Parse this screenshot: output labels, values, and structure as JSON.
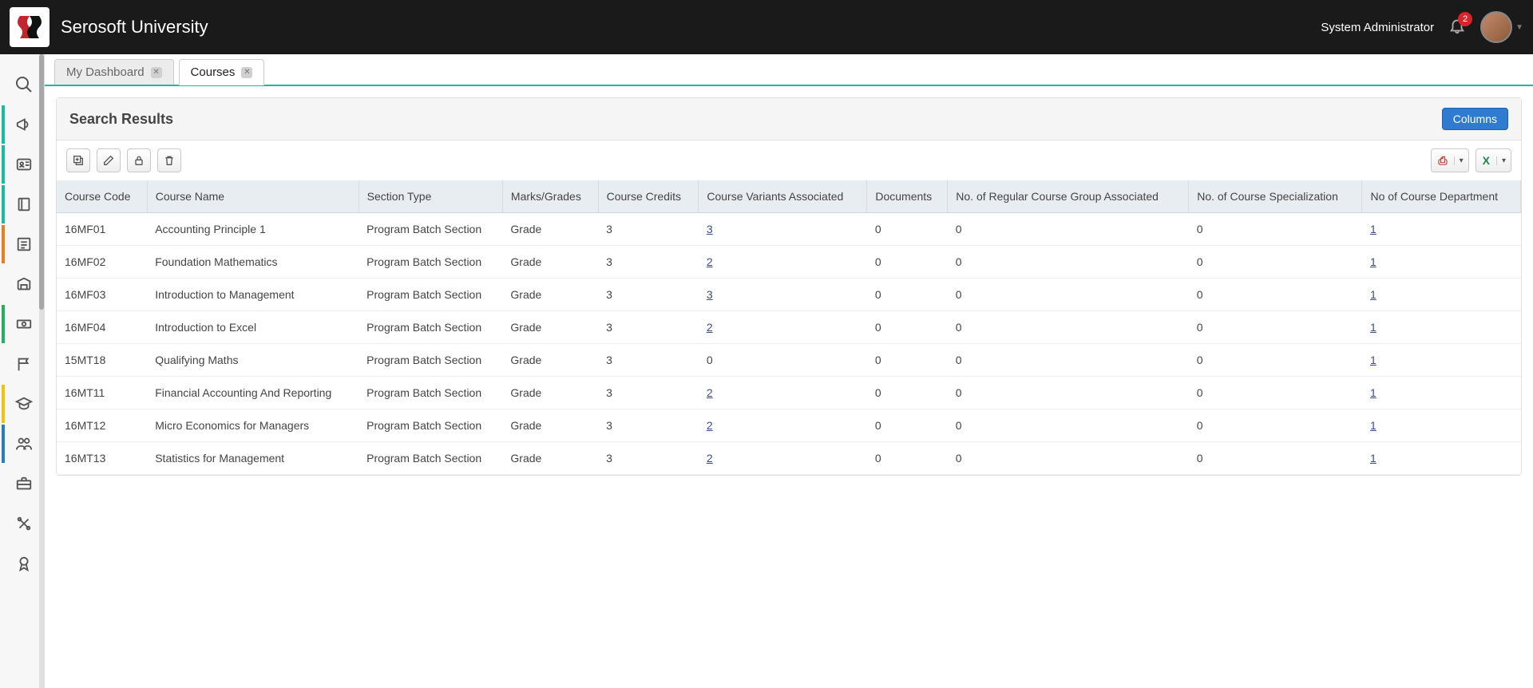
{
  "header": {
    "brand": "Serosoft University",
    "user_role": "System Administrator",
    "notification_count": "2"
  },
  "tabs": [
    {
      "label": "My Dashboard",
      "active": false
    },
    {
      "label": "Courses",
      "active": true
    }
  ],
  "panel": {
    "title": "Search Results",
    "columns_btn": "Columns"
  },
  "columns": [
    "Course Code",
    "Course Name",
    "Section Type",
    "Marks/Grades",
    "Course Credits",
    "Course Variants Associated",
    "Documents",
    "No. of Regular Course Group Associated",
    "No. of Course Specialization",
    "No of Course Department"
  ],
  "rows": [
    {
      "code": "16MF01",
      "name": "Accounting Principle 1",
      "section": "Program Batch Section",
      "marks": "Grade",
      "credits": "3",
      "variants": "3",
      "variants_link": true,
      "documents": "0",
      "regular_group": "0",
      "specialization": "0",
      "department": "1",
      "department_link": true
    },
    {
      "code": "16MF02",
      "name": "Foundation Mathematics",
      "section": "Program Batch Section",
      "marks": "Grade",
      "credits": "3",
      "variants": "2",
      "variants_link": true,
      "documents": "0",
      "regular_group": "0",
      "specialization": "0",
      "department": "1",
      "department_link": true
    },
    {
      "code": "16MF03",
      "name": "Introduction to Management",
      "section": "Program Batch Section",
      "marks": "Grade",
      "credits": "3",
      "variants": "3",
      "variants_link": true,
      "documents": "0",
      "regular_group": "0",
      "specialization": "0",
      "department": "1",
      "department_link": true
    },
    {
      "code": "16MF04",
      "name": "Introduction to Excel",
      "section": "Program Batch Section",
      "marks": "Grade",
      "credits": "3",
      "variants": "2",
      "variants_link": true,
      "documents": "0",
      "regular_group": "0",
      "specialization": "0",
      "department": "1",
      "department_link": true
    },
    {
      "code": "15MT18",
      "name": "Qualifying Maths",
      "section": "Program Batch Section",
      "marks": "Grade",
      "credits": "3",
      "variants": "0",
      "variants_link": false,
      "documents": "0",
      "regular_group": "0",
      "specialization": "0",
      "department": "1",
      "department_link": true
    },
    {
      "code": "16MT11",
      "name": "Financial Accounting And Reporting",
      "section": "Program Batch Section",
      "marks": "Grade",
      "credits": "3",
      "variants": "2",
      "variants_link": true,
      "documents": "0",
      "regular_group": "0",
      "specialization": "0",
      "department": "1",
      "department_link": true
    },
    {
      "code": "16MT12",
      "name": "Micro Economics for Managers",
      "section": "Program Batch Section",
      "marks": "Grade",
      "credits": "3",
      "variants": "2",
      "variants_link": true,
      "documents": "0",
      "regular_group": "0",
      "specialization": "0",
      "department": "1",
      "department_link": true
    },
    {
      "code": "16MT13",
      "name": "Statistics for Management",
      "section": "Program Batch Section",
      "marks": "Grade",
      "credits": "3",
      "variants": "2",
      "variants_link": true,
      "documents": "0",
      "regular_group": "0",
      "specialization": "0",
      "department": "1",
      "department_link": true
    }
  ],
  "sidebar_icons": [
    "search-icon",
    "megaphone-icon",
    "id-card-icon",
    "book-icon",
    "form-icon",
    "library-icon",
    "cash-icon",
    "flag-icon",
    "graduate-icon",
    "users-icon",
    "briefcase-icon",
    "tools-icon",
    "certificate-icon"
  ]
}
